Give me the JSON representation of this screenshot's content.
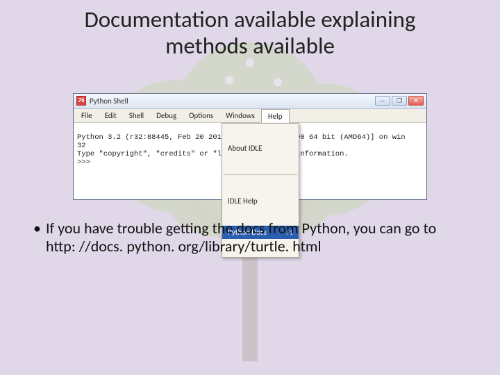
{
  "slide": {
    "title": "Documentation available explaining methods available",
    "bullet_dot": "•",
    "bullet_text": "If you have trouble getting the docs from Python, you can go to http: //docs. python. org/library/turtle. html"
  },
  "window": {
    "app_icon_text": "76",
    "title": "Python Shell",
    "buttons": {
      "min": "—",
      "max": "❐",
      "close": "✕"
    },
    "menubar": [
      "File",
      "Edit",
      "Shell",
      "Debug",
      "Options",
      "Windows",
      "Help"
    ],
    "help_menu": {
      "item_about": "About IDLE",
      "item_idlehelp": "IDLE Help",
      "item_pydocs": "Python Docs",
      "item_pydocs_shortcut": "F1"
    },
    "shell_lines": {
      "l1a": "Python 3.2 (r32:88445, Feb 20 201",
      "l1b": " v.1500 64 bit (AMD64)] on win",
      "l2": "32",
      "l3a": "Type \"copyright\", \"credits\" or \"li",
      "l3b": "e information.",
      "prompt": ">>> "
    }
  }
}
